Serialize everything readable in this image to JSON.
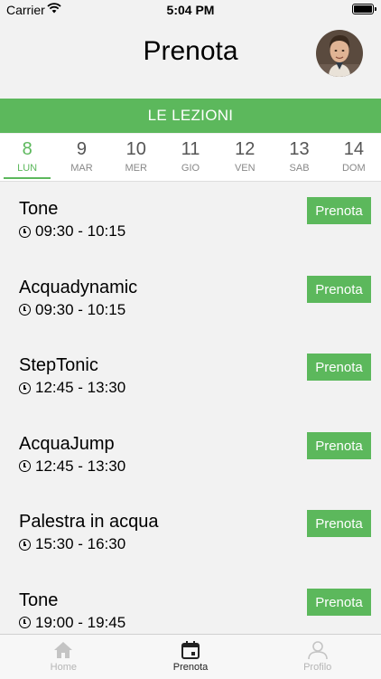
{
  "status": {
    "carrier": "Carrier",
    "time": "5:04 PM"
  },
  "header": {
    "title": "Prenota"
  },
  "section": {
    "label": "LE LEZIONI"
  },
  "days": [
    {
      "num": "8",
      "label": "LUN",
      "active": true
    },
    {
      "num": "9",
      "label": "MAR"
    },
    {
      "num": "10",
      "label": "MER"
    },
    {
      "num": "11",
      "label": "GIO"
    },
    {
      "num": "12",
      "label": "VEN"
    },
    {
      "num": "13",
      "label": "SAB"
    },
    {
      "num": "14",
      "label": "DOM"
    }
  ],
  "lessons": [
    {
      "name": "Tone",
      "time": "09:30 - 10:15",
      "button": "Prenota"
    },
    {
      "name": "Acquadynamic",
      "time": "09:30 - 10:15",
      "button": "Prenota"
    },
    {
      "name": "StepTonic",
      "time": "12:45 - 13:30",
      "button": "Prenota"
    },
    {
      "name": "AcquaJump",
      "time": "12:45 - 13:30",
      "button": "Prenota"
    },
    {
      "name": "Palestra in acqua",
      "time": "15:30 - 16:30",
      "button": "Prenota"
    },
    {
      "name": "Tone",
      "time": "19:00 - 19:45",
      "button": "Prenota"
    }
  ],
  "tabs": [
    {
      "label": "Home",
      "icon": "home-icon"
    },
    {
      "label": "Prenota",
      "icon": "calendar-icon",
      "active": true
    },
    {
      "label": "Profilo",
      "icon": "person-icon"
    }
  ],
  "colors": {
    "accent": "#5cb85c",
    "background": "#f2f2f2",
    "inactive": "#b5b5b5"
  }
}
